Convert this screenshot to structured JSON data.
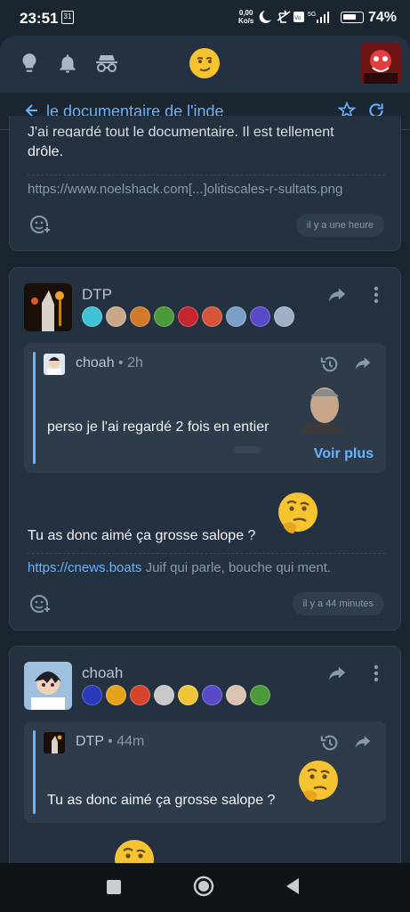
{
  "status_bar": {
    "time": "23:51",
    "calendar_day": "31",
    "net_speed_value": "0,00",
    "net_speed_unit": "Ko/s",
    "battery_level": 0.74,
    "battery_pct": "74%"
  },
  "header": {
    "icons": [
      "lightbulb-icon",
      "bell-icon",
      "incognito-icon"
    ],
    "emoji": "smirk-emoji"
  },
  "topic": {
    "title": "le documentaire de l'inde",
    "back_icon": "arrow-left-icon",
    "star_icon": "star-icon",
    "refresh_icon": "refresh-icon"
  },
  "posts": [
    {
      "body_partial": "J'ai regardé tout le documentaire. Il est tellement",
      "body": "drôle.",
      "link": "https://www.noelshack.com[...]olitiscales-r-sultats.png",
      "time": "il y a une heure"
    },
    {
      "author": "DTP",
      "quote": {
        "author": "choah",
        "age": "2h",
        "separator": "•",
        "text": "perso je l'ai regardé 2 fois en entier",
        "more": "Voir plus"
      },
      "body": "Tu as donc aimé ça grosse salope ?",
      "sig_link": "https://cnews.boats",
      "sig_text": "Juif qui parle, bouche qui ment.",
      "time": "il y a 44 minutes"
    },
    {
      "author": "choah",
      "quote": {
        "author": "DTP",
        "age": "44m",
        "separator": "•",
        "text": "Tu as donc aimé ça grosse salope ?"
      }
    }
  ],
  "colors": {
    "accent": "#67b3ff",
    "background": "#1b2530",
    "card": "#243140",
    "quote": "#2e3b4a"
  }
}
